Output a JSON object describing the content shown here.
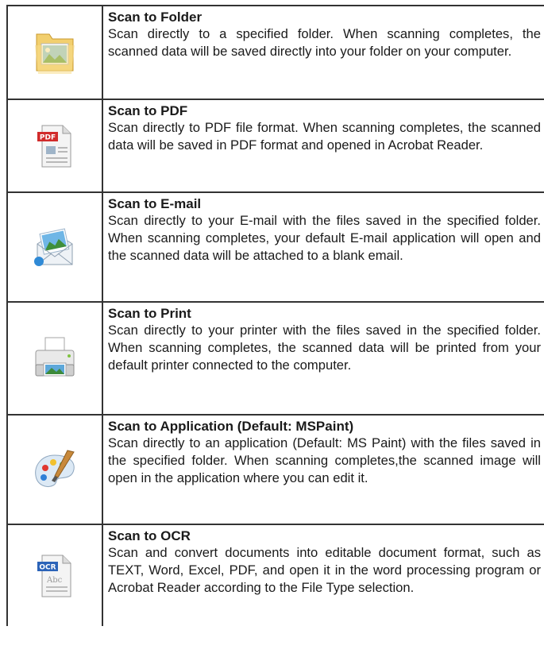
{
  "entries": [
    {
      "icon": "folder-picture-icon",
      "title": "Scan to Folder",
      "description": "Scan directly to a specified folder. When scanning completes, the scanned data will be saved directly into your folder on your computer."
    },
    {
      "icon": "pdf-document-icon",
      "icon_label": "PDF",
      "title": "Scan to PDF",
      "description": "Scan directly to PDF file format. When scanning completes, the scanned data will be saved in PDF format and opened in Acrobat Reader."
    },
    {
      "icon": "email-envelope-icon",
      "title": "Scan to E-mail",
      "description": "Scan directly to your E-mail with the files saved in the specified folder. When scanning completes, your default E-mail application will open and the scanned data will be attached to a blank email."
    },
    {
      "icon": "printer-icon",
      "title": "Scan to Print",
      "description": "Scan directly to your printer with the files saved in the specified folder. When scanning completes, the scanned data will be printed from your default printer connected to the computer."
    },
    {
      "icon": "paint-palette-icon",
      "title": "Scan to Application (Default: MSPaint)",
      "description": "Scan directly to an application (Default: MS Paint) with the files saved in the specified folder. When scanning completes,the scanned image will open in the application where you can edit it."
    },
    {
      "icon": "ocr-document-icon",
      "icon_label": "OCR",
      "icon_sublabel": "Abc",
      "title": "Scan to OCR",
      "description": "Scan and convert documents into editable document format, such as TEXT, Word, Excel, PDF, and open it in the word processing program or Acrobat Reader according to the File Type selection."
    }
  ]
}
